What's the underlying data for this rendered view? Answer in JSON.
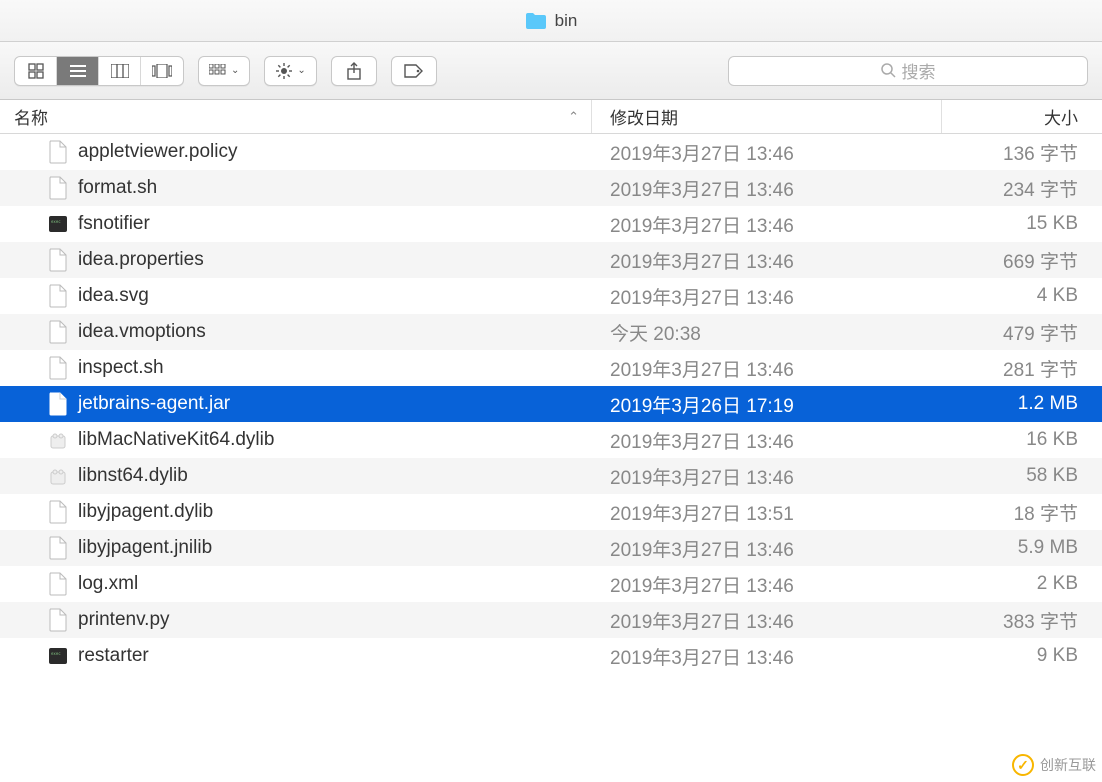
{
  "window": {
    "title": "bin"
  },
  "toolbar": {
    "search_placeholder": "搜索"
  },
  "columns": {
    "name": "名称",
    "date": "修改日期",
    "size": "大小"
  },
  "files": [
    {
      "name": "appletviewer.policy",
      "date": "2019年3月27日 13:46",
      "size": "136 字节",
      "icon": "file",
      "selected": false
    },
    {
      "name": "format.sh",
      "date": "2019年3月27日 13:46",
      "size": "234 字节",
      "icon": "file",
      "selected": false
    },
    {
      "name": "fsnotifier",
      "date": "2019年3月27日 13:46",
      "size": "15 KB",
      "icon": "exec",
      "selected": false
    },
    {
      "name": "idea.properties",
      "date": "2019年3月27日 13:46",
      "size": "669 字节",
      "icon": "file",
      "selected": false
    },
    {
      "name": "idea.svg",
      "date": "2019年3月27日 13:46",
      "size": "4 KB",
      "icon": "file",
      "selected": false
    },
    {
      "name": "idea.vmoptions",
      "date": "今天 20:38",
      "size": "479 字节",
      "icon": "file",
      "selected": false
    },
    {
      "name": "inspect.sh",
      "date": "2019年3月27日 13:46",
      "size": "281 字节",
      "icon": "file",
      "selected": false
    },
    {
      "name": "jetbrains-agent.jar",
      "date": "2019年3月26日 17:19",
      "size": "1.2 MB",
      "icon": "file",
      "selected": true
    },
    {
      "name": "libMacNativeKit64.dylib",
      "date": "2019年3月27日 13:46",
      "size": "16 KB",
      "icon": "lego",
      "selected": false
    },
    {
      "name": "libnst64.dylib",
      "date": "2019年3月27日 13:46",
      "size": "58 KB",
      "icon": "lego",
      "selected": false
    },
    {
      "name": "libyjpagent.dylib",
      "date": "2019年3月27日 13:51",
      "size": "18 字节",
      "icon": "file",
      "selected": false
    },
    {
      "name": "libyjpagent.jnilib",
      "date": "2019年3月27日 13:46",
      "size": "5.9 MB",
      "icon": "file",
      "selected": false
    },
    {
      "name": "log.xml",
      "date": "2019年3月27日 13:46",
      "size": "2 KB",
      "icon": "file",
      "selected": false
    },
    {
      "name": "printenv.py",
      "date": "2019年3月27日 13:46",
      "size": "383 字节",
      "icon": "file",
      "selected": false
    },
    {
      "name": "restarter",
      "date": "2019年3月27日 13:46",
      "size": "9 KB",
      "icon": "exec",
      "selected": false
    }
  ],
  "watermark": {
    "text": "创新互联"
  }
}
